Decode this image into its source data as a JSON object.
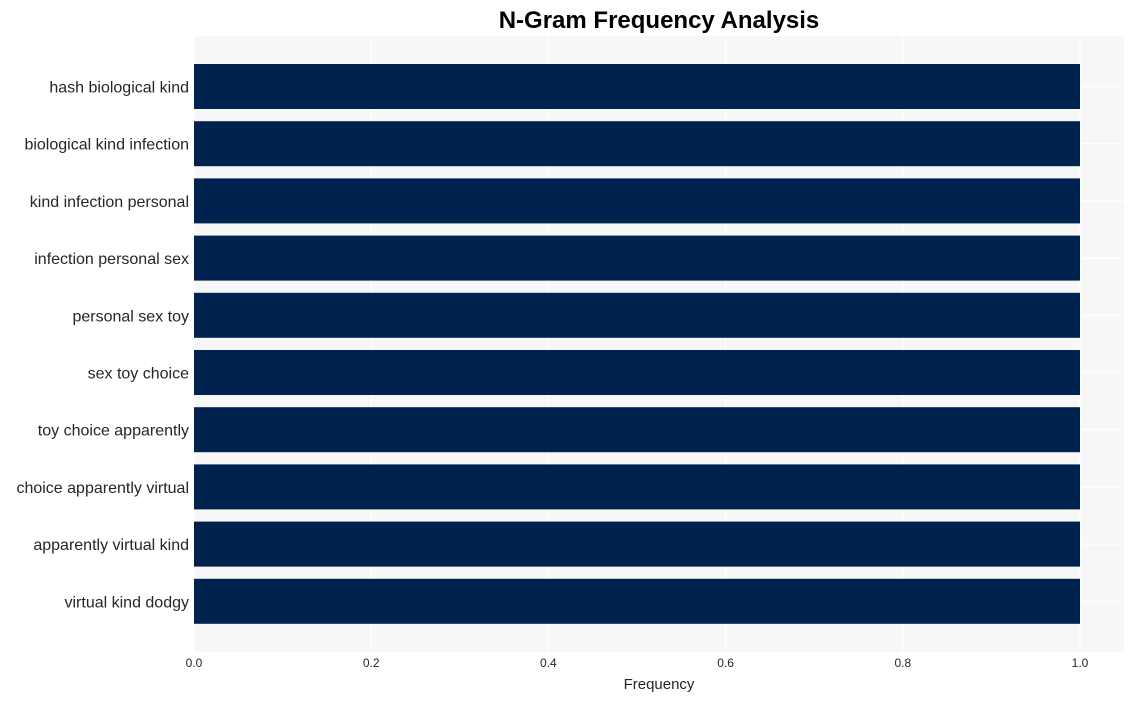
{
  "chart_data": {
    "type": "bar",
    "orientation": "horizontal",
    "title": "N-Gram Frequency Analysis",
    "xlabel": "Frequency",
    "ylabel": "",
    "categories": [
      "hash biological kind",
      "biological kind infection",
      "kind infection personal",
      "infection personal sex",
      "personal sex toy",
      "sex toy choice",
      "toy choice apparently",
      "choice apparently virtual",
      "apparently virtual kind",
      "virtual kind dodgy"
    ],
    "values": [
      1,
      1,
      1,
      1,
      1,
      1,
      1,
      1,
      1,
      1
    ],
    "xlim": [
      0,
      1.05
    ],
    "xticks": [
      "0.0",
      "0.2",
      "0.4",
      "0.6",
      "0.8",
      "1.0"
    ],
    "grid": true,
    "legend": "none",
    "colors": {
      "bar": "#00224e",
      "plot_background": "#f7f7f7",
      "grid": "#ffffff"
    }
  }
}
